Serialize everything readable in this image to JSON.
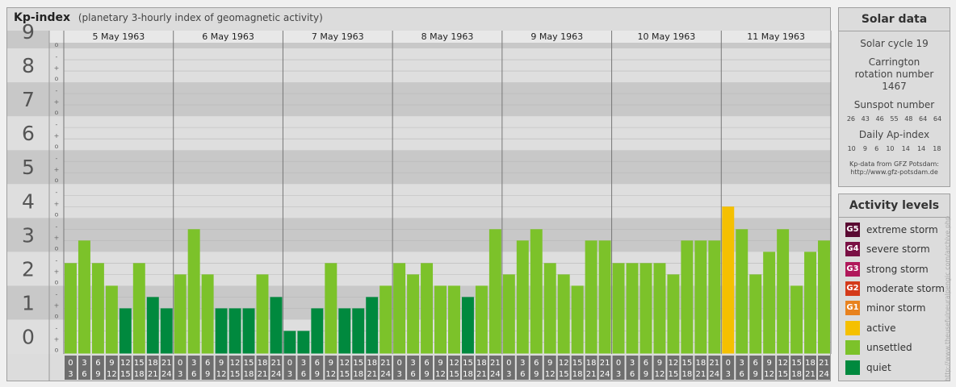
{
  "header": {
    "title": "Kp-index",
    "subtitle": "(planetary 3-hourly index of geomagnetic activity)"
  },
  "solar": {
    "heading": "Solar data",
    "cycle": "Solar cycle 19",
    "carrington": "Carrington rotation number 1467",
    "sunspot_label": "Sunspot number",
    "sunspot_values": [
      "26",
      "43",
      "46",
      "55",
      "48",
      "64",
      "64"
    ],
    "ap_label": "Daily Ap-index",
    "ap_values": [
      "10",
      "9",
      "6",
      "10",
      "14",
      "14",
      "18"
    ],
    "source_line1": "Kp-data from GFZ Potsdam:",
    "source_line2": "http://www.gfz-potsdam.de"
  },
  "activity": {
    "heading": "Activity levels",
    "levels": [
      {
        "code": "G5",
        "label": "extreme storm",
        "color": "#5a0a32"
      },
      {
        "code": "G4",
        "label": "severe storm",
        "color": "#7a1044"
      },
      {
        "code": "G3",
        "label": "strong storm",
        "color": "#b0185a"
      },
      {
        "code": "G2",
        "label": "moderate storm",
        "color": "#d43a1a"
      },
      {
        "code": "G1",
        "label": "minor storm",
        "color": "#e8821e"
      },
      {
        "code": "",
        "label": "active",
        "color": "#f5c000"
      },
      {
        "code": "",
        "label": "unsettled",
        "color": "#7cc22a"
      },
      {
        "code": "",
        "label": "quiet",
        "color": "#00893e"
      }
    ]
  },
  "credit": "http://www.theusefulneuralpengic.com/archive.php",
  "chart_data": {
    "type": "bar",
    "title": "Kp-index",
    "ylim": [
      0,
      9
    ],
    "y_ticks": [
      "0",
      "1",
      "2",
      "3",
      "4",
      "5",
      "6",
      "7",
      "8",
      "9"
    ],
    "sub_ticks": [
      "o",
      "+",
      "-"
    ],
    "days": [
      "5 May 1963",
      "6 May 1963",
      "7 May 1963",
      "8 May 1963",
      "9 May 1963",
      "10 May 1963",
      "11 May 1963"
    ],
    "interval_top": [
      "0",
      "3",
      "6",
      "9",
      "12",
      "15",
      "18",
      "21"
    ],
    "interval_bottom": [
      "3",
      "6",
      "9",
      "12",
      "15",
      "18",
      "21",
      "24"
    ],
    "values": [
      [
        2.667,
        3.333,
        2.667,
        2.0,
        1.333,
        2.667,
        1.667,
        1.333
      ],
      [
        2.333,
        3.667,
        2.333,
        1.333,
        1.333,
        1.333,
        2.333,
        1.667
      ],
      [
        0.667,
        0.667,
        1.333,
        2.667,
        1.333,
        1.333,
        1.667,
        2.0
      ],
      [
        2.667,
        2.333,
        2.667,
        2.0,
        2.0,
        1.667,
        2.0,
        3.667
      ],
      [
        2.333,
        3.333,
        3.667,
        2.667,
        2.333,
        2.0,
        3.333,
        3.333
      ],
      [
        2.667,
        2.667,
        2.667,
        2.667,
        2.333,
        3.333,
        3.333,
        3.333
      ],
      [
        4.333,
        3.667,
        2.333,
        3.0,
        3.667,
        2.0,
        3.0,
        3.333
      ]
    ],
    "colors": {
      "quiet": "#00893e",
      "unsettled": "#7cc22a",
      "active": "#f5c000"
    }
  }
}
